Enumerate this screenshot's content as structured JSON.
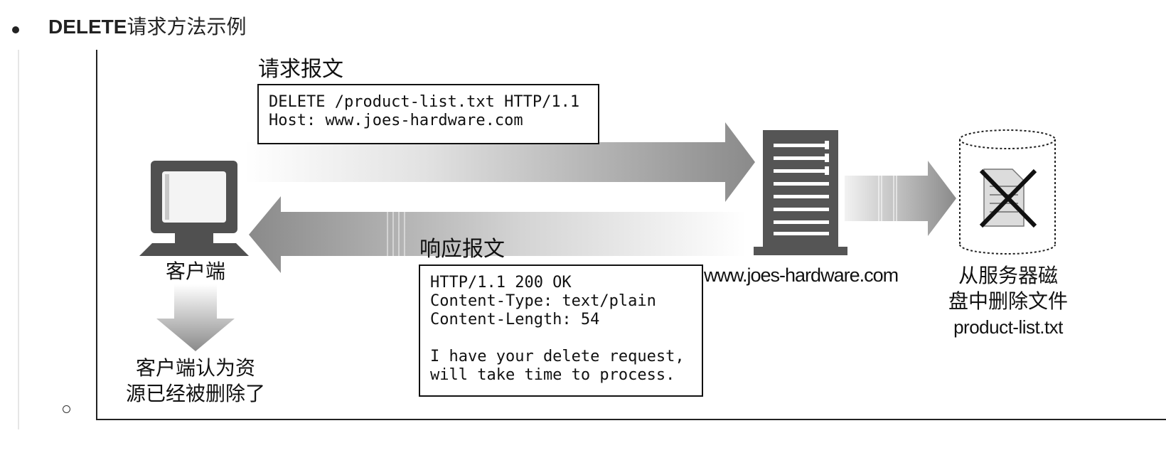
{
  "heading": {
    "method": "DELETE",
    "text": "请求方法示例"
  },
  "figure": {
    "request_label": "请求报文",
    "request_lines": [
      "DELETE /product-list.txt HTTP/1.1",
      "Host: www.joes-hardware.com"
    ],
    "response_label": "响应报文",
    "response_lines": [
      "HTTP/1.1 200 OK",
      "Content-Type: text/plain",
      "Content-Length: 54",
      "",
      "I have your delete request,",
      "will take time to process."
    ],
    "client_label": "客户端",
    "client_note_lines": [
      "客户端认为资",
      "源已经被删除了"
    ],
    "server_label": "www.joes-hardware.com",
    "disk_note_lines": [
      "从服务器磁",
      "盘中删除文件",
      "product-list.txt"
    ]
  }
}
